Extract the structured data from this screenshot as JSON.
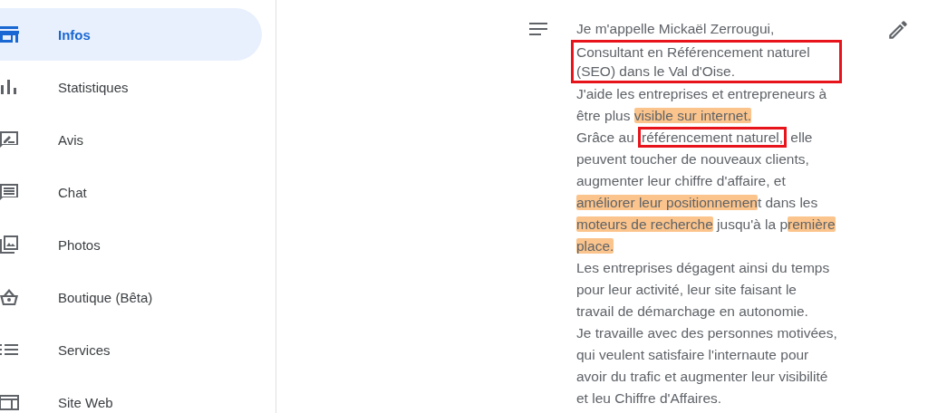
{
  "sidebar": {
    "items": [
      {
        "label": "Infos",
        "selected": true
      },
      {
        "label": "Statistiques",
        "selected": false
      },
      {
        "label": "Avis",
        "selected": false
      },
      {
        "label": "Chat",
        "selected": false
      },
      {
        "label": "Photos",
        "selected": false
      },
      {
        "label": "Boutique (Bêta)",
        "selected": false
      },
      {
        "label": "Services",
        "selected": false
      },
      {
        "label": "Site Web",
        "selected": false
      }
    ]
  },
  "description": {
    "blocks": [
      {
        "kind": "line",
        "segments": [
          {
            "text": "Je m'appelle Mickaël Zerrougui,",
            "highlighted": false,
            "boxed": false
          }
        ]
      },
      {
        "kind": "boxed",
        "lines": [
          {
            "segments": [
              {
                "text": "Consultant en Référencement naturel",
                "highlighted": false,
                "boxed": false
              }
            ]
          },
          {
            "segments": [
              {
                "text": "(SEO) dans le Val d'Oise.",
                "highlighted": false,
                "boxed": false
              }
            ]
          }
        ]
      },
      {
        "kind": "line",
        "segments": [
          {
            "text": "J'aide les entreprises et entrepreneurs à",
            "highlighted": false,
            "boxed": false
          }
        ]
      },
      {
        "kind": "line",
        "segments": [
          {
            "text": "être plus ",
            "highlighted": false,
            "boxed": false
          },
          {
            "text": "visible sur internet.",
            "highlighted": true,
            "boxed": false
          }
        ]
      },
      {
        "kind": "line",
        "segments": [
          {
            "text": "Grâce au ",
            "highlighted": false,
            "boxed": false
          },
          {
            "text": "référencement naturel,",
            "highlighted": false,
            "boxed": true
          },
          {
            "text": " elle",
            "highlighted": false,
            "boxed": false
          }
        ]
      },
      {
        "kind": "line",
        "segments": [
          {
            "text": "peuvent toucher de nouveaux clients,",
            "highlighted": false,
            "boxed": false
          }
        ]
      },
      {
        "kind": "line",
        "segments": [
          {
            "text": "augmenter leur chiffre d'affaire, et",
            "highlighted": false,
            "boxed": false
          }
        ]
      },
      {
        "kind": "line",
        "segments": [
          {
            "text": "améliorer leur positionnemen",
            "highlighted": true,
            "boxed": false
          },
          {
            "text": "t dans les",
            "highlighted": false,
            "boxed": false
          }
        ]
      },
      {
        "kind": "line",
        "segments": [
          {
            "text": "moteurs de recherche",
            "highlighted": true,
            "boxed": false
          },
          {
            "text": " jusqu'à la p",
            "highlighted": false,
            "boxed": false
          },
          {
            "text": "remière",
            "highlighted": true,
            "boxed": false
          }
        ]
      },
      {
        "kind": "line",
        "segments": [
          {
            "text": "place.",
            "highlighted": true,
            "boxed": false
          }
        ]
      },
      {
        "kind": "line",
        "segments": [
          {
            "text": "Les entreprises dégagent ainsi du temps",
            "highlighted": false,
            "boxed": false
          }
        ]
      },
      {
        "kind": "line",
        "segments": [
          {
            "text": "pour leur activité, leur site faisant le",
            "highlighted": false,
            "boxed": false
          }
        ]
      },
      {
        "kind": "line",
        "segments": [
          {
            "text": "travail de démarchage en autonomie.",
            "highlighted": false,
            "boxed": false
          }
        ]
      },
      {
        "kind": "line",
        "segments": [
          {
            "text": "Je travaille avec des personnes motivées,",
            "highlighted": false,
            "boxed": false
          }
        ]
      },
      {
        "kind": "line",
        "segments": [
          {
            "text": "qui veulent satisfaire l'internaute pour",
            "highlighted": false,
            "boxed": false
          }
        ]
      },
      {
        "kind": "line",
        "segments": [
          {
            "text": "avoir du trafic et augmenter leur visibilité",
            "highlighted": false,
            "boxed": false
          }
        ]
      },
      {
        "kind": "line",
        "segments": [
          {
            "text": "et leu Chiffre d'Affaires.",
            "highlighted": false,
            "boxed": false
          }
        ]
      }
    ]
  }
}
